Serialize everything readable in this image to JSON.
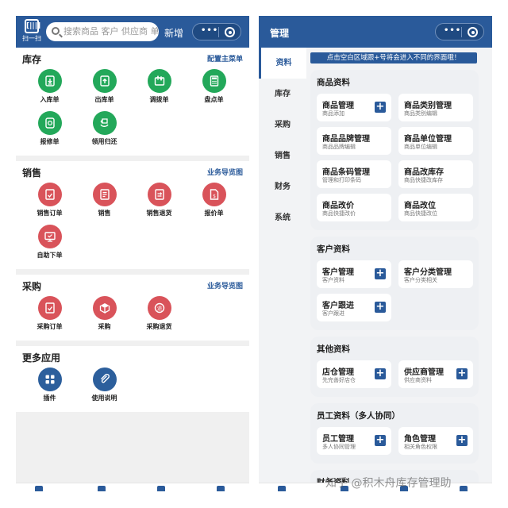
{
  "left": {
    "scan_glyph": "[|||]",
    "scan_label": "扫一扫",
    "search_placeholder": "搜索商品 客户 供应商 单",
    "add_new": "新增",
    "capsule_dots": "•••",
    "sections": [
      {
        "title": "库存",
        "link": "配置主菜单",
        "items": [
          {
            "label": "入库单",
            "color": "green",
            "icon": "inbound-icon"
          },
          {
            "label": "出库单",
            "color": "green",
            "icon": "outbound-icon"
          },
          {
            "label": "调拨单",
            "color": "green",
            "icon": "transfer-icon"
          },
          {
            "label": "盘点单",
            "color": "green",
            "icon": "stocktake-icon"
          },
          {
            "label": "报修单",
            "color": "green",
            "icon": "repair-icon"
          },
          {
            "label": "领用归还",
            "color": "green",
            "icon": "return-icon"
          }
        ]
      },
      {
        "title": "销售",
        "link": "业务导览图",
        "items": [
          {
            "label": "销售订单",
            "color": "red",
            "icon": "sales-order-icon"
          },
          {
            "label": "销售",
            "color": "red",
            "icon": "sales-icon"
          },
          {
            "label": "销售退货",
            "color": "red",
            "icon": "sales-return-icon"
          },
          {
            "label": "报价单",
            "color": "red",
            "icon": "quote-icon"
          },
          {
            "label": "自助下单",
            "color": "red",
            "icon": "self-order-icon"
          }
        ]
      },
      {
        "title": "采购",
        "link": "业务导览图",
        "items": [
          {
            "label": "采购订单",
            "color": "red",
            "icon": "purchase-order-icon"
          },
          {
            "label": "采购",
            "color": "red",
            "icon": "purchase-icon"
          },
          {
            "label": "采购退货",
            "color": "red",
            "icon": "purchase-return-icon"
          }
        ]
      },
      {
        "title": "更多应用",
        "link": "",
        "items": [
          {
            "label": "插件",
            "color": "blue",
            "icon": "plugin-icon"
          },
          {
            "label": "使用说明",
            "color": "blue",
            "icon": "manual-icon"
          }
        ]
      }
    ]
  },
  "right": {
    "title": "管理",
    "capsule_dots": "•••",
    "sidebar": [
      "资料",
      "库存",
      "采购",
      "销售",
      "财务",
      "系统"
    ],
    "active_tab": 0,
    "notice": "点击空白区域跟+号将会进入不同的界面哦！",
    "cards": [
      {
        "title": "商品资料",
        "items": [
          {
            "name": "商品管理",
            "sub": "商品添加",
            "plus": true
          },
          {
            "name": "商品类别管理",
            "sub": "商品类别编辑",
            "plus": false
          },
          {
            "name": "商品品牌管理",
            "sub": "商品品牌编辑",
            "plus": false
          },
          {
            "name": "商品单位管理",
            "sub": "商品单位编辑",
            "plus": false
          },
          {
            "name": "商品条码管理",
            "sub": "管理和打印条码",
            "plus": false
          },
          {
            "name": "商品改库存",
            "sub": "商品快捷改库存",
            "plus": false
          },
          {
            "name": "商品改价",
            "sub": "商品快捷改价",
            "plus": false
          },
          {
            "name": "商品改位",
            "sub": "商品快捷改位",
            "plus": false
          }
        ]
      },
      {
        "title": "客户资料",
        "items": [
          {
            "name": "客户管理",
            "sub": "客户资料",
            "plus": true
          },
          {
            "name": "客户分类管理",
            "sub": "客户分类相关",
            "plus": false
          },
          {
            "name": "客户跟进",
            "sub": "客户跟进",
            "plus": true
          }
        ]
      },
      {
        "title": "其他资料",
        "items": [
          {
            "name": "店仓管理",
            "sub": "先完善好店仓",
            "plus": true
          },
          {
            "name": "供应商管理",
            "sub": "供应商资料",
            "plus": true
          }
        ]
      },
      {
        "title": "员工资料（多人协同）",
        "items": [
          {
            "name": "员工管理",
            "sub": "多人协同管理",
            "plus": true
          },
          {
            "name": "角色管理",
            "sub": "相关角色权限",
            "plus": true
          }
        ]
      },
      {
        "title": "财务资料",
        "items": []
      }
    ]
  },
  "watermark": "知乎 @积木舟库存管理助",
  "colors": {
    "primary": "#2a5a9a",
    "green": "#23a85a",
    "red": "#d9535a",
    "blue": "#2c5f9c"
  }
}
